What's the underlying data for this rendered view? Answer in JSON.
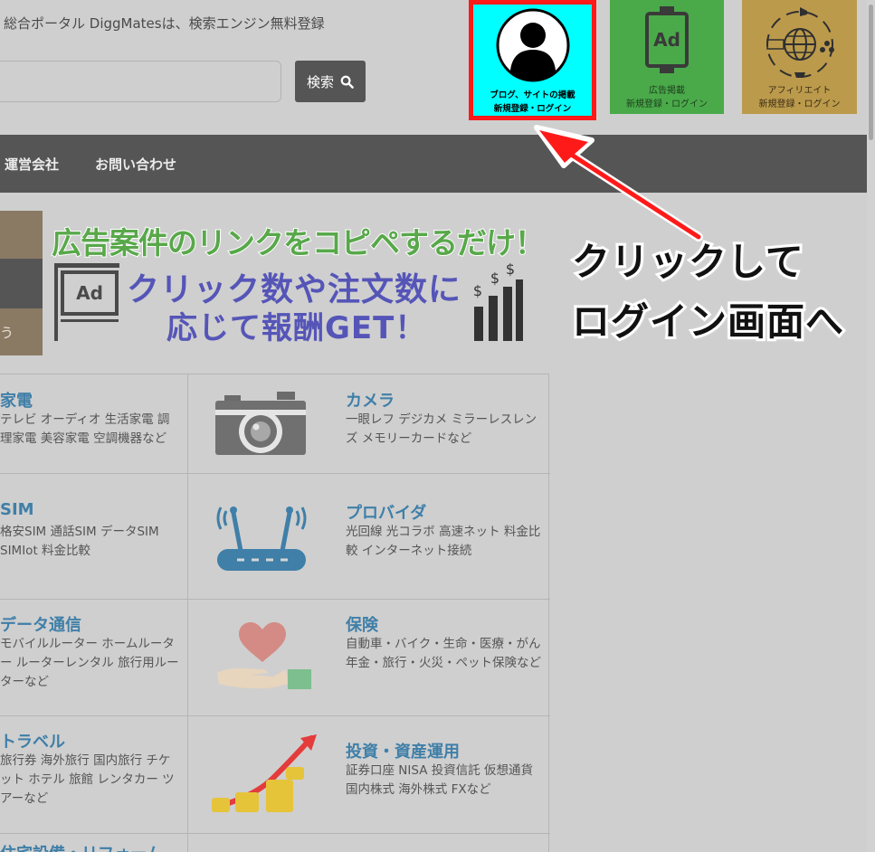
{
  "header": {
    "tagline": "総合ポータル DiggMatesは、検索エンジン無料登録",
    "search_label": "検索"
  },
  "tiles": [
    {
      "line1": "ブログ、サイトの掲載",
      "line2": "新規登録・ログイン",
      "icon": "user-icon",
      "color": "#00ffff"
    },
    {
      "line1": "広告掲載",
      "line2": "新規登録・ログイン",
      "icon": "ad-sign-icon",
      "color": "#4aaa4a"
    },
    {
      "line1": "アフィリエイト",
      "line2": "新規登録・ログイン",
      "icon": "globe-network-icon",
      "color": "#bb9a4c"
    }
  ],
  "nav": [
    "運営会社",
    "お問い合わせ"
  ],
  "banner": {
    "headline": "広告案件のリンクをコピペするだけ！",
    "sub_line1": "クリック数や注文数に",
    "sub_line2": "応じて報酬GET！",
    "ad_label": "Ad",
    "left_fragment": "う"
  },
  "categories_left": [
    {
      "title": "家電",
      "desc": "テレビ オーディオ 生活家電 調理家電 美容家電 空調機器など"
    },
    {
      "title": "SIM",
      "desc": "格安SIM 通話SIM データSIM SIMIot 料金比較"
    },
    {
      "title": "データ通信",
      "desc": "モバイルルーター ホームルーター ルーターレンタル 旅行用ルーターなど"
    },
    {
      "title": "トラベル",
      "desc": "旅行券 海外旅行 国内旅行 チケット ホテル 旅館 レンタカー ツアーなど"
    },
    {
      "title": "住宅設備・リフォーム"
    }
  ],
  "categories_right": [
    {
      "title": "カメラ",
      "desc": "一眼レフ デジカメ ミラーレスレンズ メモリーカードなど",
      "icon": "camera-icon"
    },
    {
      "title": "プロバイダ",
      "desc": "光回線 光コラボ 高速ネット 料金比較 インターネット接続",
      "icon": "router-icon"
    },
    {
      "title": "保険",
      "desc": "自動車・バイク・生命・医療・がん年金・旅行・火災・ペット保険など",
      "icon": "heart-hand-icon"
    },
    {
      "title": "投資・資産運用",
      "desc": "証券口座 NISA 投資信託 仮想通貨 国内株式 海外株式 FXなど",
      "icon": "investment-growth-icon"
    }
  ],
  "callout": {
    "line1": "クリックして",
    "line2": "ログイン画面へ"
  },
  "colors": {
    "highlight_border": "#ff1a1a",
    "arrow": "#ff1a1a",
    "category_title": "#3f7fa8",
    "nav_bg": "#555555"
  }
}
